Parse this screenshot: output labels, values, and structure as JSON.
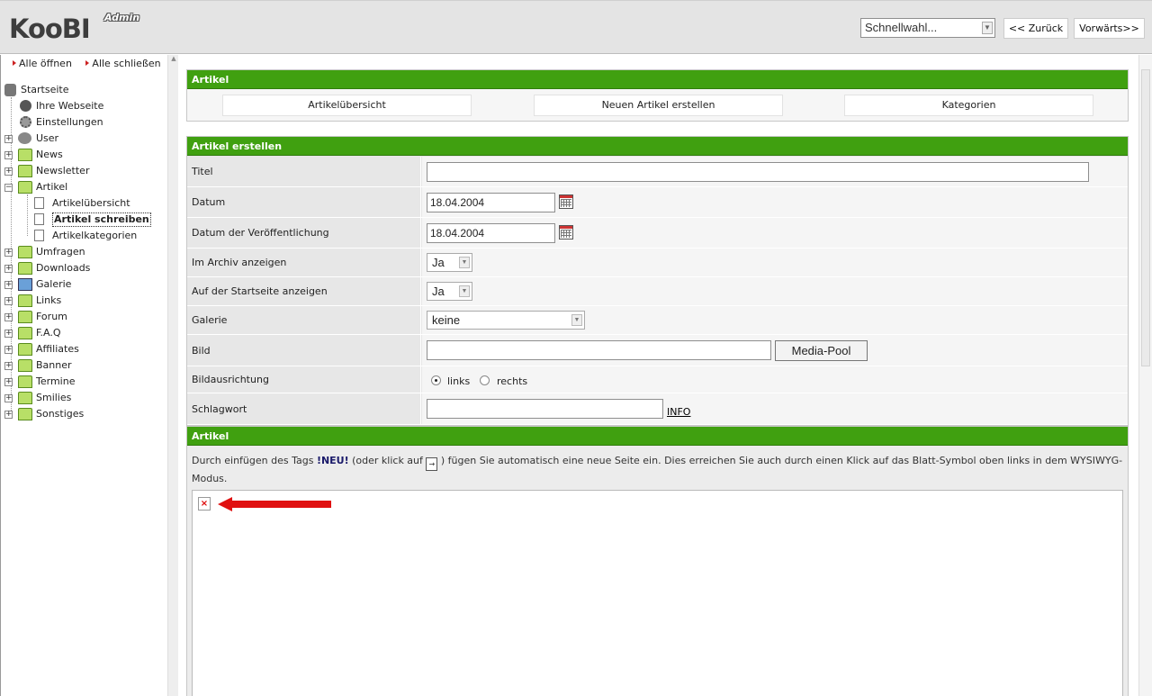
{
  "header": {
    "logo_text": "KooBI",
    "logo_badge": "Admin",
    "quick_select_value": "Schnellwahl...",
    "back_label": "<< Zurück",
    "forward_label": "Vorwärts>>"
  },
  "sidebar": {
    "open_all": "Alle öffnen",
    "close_all": "Alle schließen",
    "items": [
      {
        "label": "Startseite"
      },
      {
        "label": "Ihre Webseite"
      },
      {
        "label": "Einstellungen"
      },
      {
        "label": "User"
      },
      {
        "label": "News"
      },
      {
        "label": "Newsletter"
      },
      {
        "label": "Artikel"
      },
      {
        "label": "Artikelübersicht"
      },
      {
        "label": "Artikel schreiben"
      },
      {
        "label": "Artikelkategorien"
      },
      {
        "label": "Umfragen"
      },
      {
        "label": "Downloads"
      },
      {
        "label": "Galerie"
      },
      {
        "label": "Links"
      },
      {
        "label": "Forum"
      },
      {
        "label": "F.A.Q"
      },
      {
        "label": "Affiliates"
      },
      {
        "label": "Banner"
      },
      {
        "label": "Termine"
      },
      {
        "label": "Smilies"
      },
      {
        "label": "Sonstiges"
      }
    ]
  },
  "nav_panel": {
    "title": "Artikel",
    "buttons": [
      "Artikelübersicht",
      "Neuen Artikel erstellen",
      "Kategorien"
    ]
  },
  "form": {
    "title": "Artikel erstellen",
    "titel_label": "Titel",
    "titel_value": "",
    "datum_label": "Datum",
    "datum_value": "18.04.2004",
    "pub_label": "Datum der Veröffentlichung",
    "pub_value": "18.04.2004",
    "archiv_label": "Im Archiv anzeigen",
    "archiv_value": "Ja",
    "start_label": "Auf der Startseite anzeigen",
    "start_value": "Ja",
    "galerie_label": "Galerie",
    "galerie_value": "keine",
    "bild_label": "Bild",
    "bild_value": "",
    "mediapool_label": "Media-Pool",
    "ausrichtung_label": "Bildausrichtung",
    "radio_links": "links",
    "radio_rechts": "rechts",
    "schlagwort_label": "Schlagwort",
    "schlagwort_value": "",
    "info_label": "INFO"
  },
  "article": {
    "title": "Artikel",
    "hint_before": "Durch einfügen des Tags ",
    "hint_tag": "!NEU!",
    "hint_mid": " (oder klick auf ",
    "hint_after": " ) fügen Sie automatisch eine neue Seite ein. Dies erreichen Sie auch durch einen Klick auf das Blatt-Symbol oben links in dem WYSIWYG-Modus."
  },
  "colors": {
    "accent_green": "#40a010",
    "arrow_red": "#e01010"
  }
}
